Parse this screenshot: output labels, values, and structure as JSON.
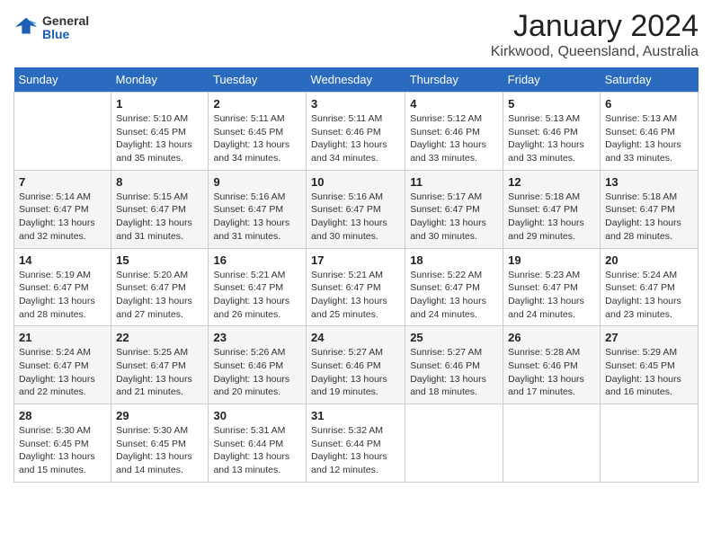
{
  "header": {
    "logo_general": "General",
    "logo_blue": "Blue",
    "month_title": "January 2024",
    "location": "Kirkwood, Queensland, Australia"
  },
  "weekdays": [
    "Sunday",
    "Monday",
    "Tuesday",
    "Wednesday",
    "Thursday",
    "Friday",
    "Saturday"
  ],
  "weeks": [
    [
      {
        "day": "",
        "sunrise": "",
        "sunset": "",
        "daylight": ""
      },
      {
        "day": "1",
        "sunrise": "Sunrise: 5:10 AM",
        "sunset": "Sunset: 6:45 PM",
        "daylight": "Daylight: 13 hours and 35 minutes."
      },
      {
        "day": "2",
        "sunrise": "Sunrise: 5:11 AM",
        "sunset": "Sunset: 6:45 PM",
        "daylight": "Daylight: 13 hours and 34 minutes."
      },
      {
        "day": "3",
        "sunrise": "Sunrise: 5:11 AM",
        "sunset": "Sunset: 6:46 PM",
        "daylight": "Daylight: 13 hours and 34 minutes."
      },
      {
        "day": "4",
        "sunrise": "Sunrise: 5:12 AM",
        "sunset": "Sunset: 6:46 PM",
        "daylight": "Daylight: 13 hours and 33 minutes."
      },
      {
        "day": "5",
        "sunrise": "Sunrise: 5:13 AM",
        "sunset": "Sunset: 6:46 PM",
        "daylight": "Daylight: 13 hours and 33 minutes."
      },
      {
        "day": "6",
        "sunrise": "Sunrise: 5:13 AM",
        "sunset": "Sunset: 6:46 PM",
        "daylight": "Daylight: 13 hours and 33 minutes."
      }
    ],
    [
      {
        "day": "7",
        "sunrise": "Sunrise: 5:14 AM",
        "sunset": "Sunset: 6:47 PM",
        "daylight": "Daylight: 13 hours and 32 minutes."
      },
      {
        "day": "8",
        "sunrise": "Sunrise: 5:15 AM",
        "sunset": "Sunset: 6:47 PM",
        "daylight": "Daylight: 13 hours and 31 minutes."
      },
      {
        "day": "9",
        "sunrise": "Sunrise: 5:16 AM",
        "sunset": "Sunset: 6:47 PM",
        "daylight": "Daylight: 13 hours and 31 minutes."
      },
      {
        "day": "10",
        "sunrise": "Sunrise: 5:16 AM",
        "sunset": "Sunset: 6:47 PM",
        "daylight": "Daylight: 13 hours and 30 minutes."
      },
      {
        "day": "11",
        "sunrise": "Sunrise: 5:17 AM",
        "sunset": "Sunset: 6:47 PM",
        "daylight": "Daylight: 13 hours and 30 minutes."
      },
      {
        "day": "12",
        "sunrise": "Sunrise: 5:18 AM",
        "sunset": "Sunset: 6:47 PM",
        "daylight": "Daylight: 13 hours and 29 minutes."
      },
      {
        "day": "13",
        "sunrise": "Sunrise: 5:18 AM",
        "sunset": "Sunset: 6:47 PM",
        "daylight": "Daylight: 13 hours and 28 minutes."
      }
    ],
    [
      {
        "day": "14",
        "sunrise": "Sunrise: 5:19 AM",
        "sunset": "Sunset: 6:47 PM",
        "daylight": "Daylight: 13 hours and 28 minutes."
      },
      {
        "day": "15",
        "sunrise": "Sunrise: 5:20 AM",
        "sunset": "Sunset: 6:47 PM",
        "daylight": "Daylight: 13 hours and 27 minutes."
      },
      {
        "day": "16",
        "sunrise": "Sunrise: 5:21 AM",
        "sunset": "Sunset: 6:47 PM",
        "daylight": "Daylight: 13 hours and 26 minutes."
      },
      {
        "day": "17",
        "sunrise": "Sunrise: 5:21 AM",
        "sunset": "Sunset: 6:47 PM",
        "daylight": "Daylight: 13 hours and 25 minutes."
      },
      {
        "day": "18",
        "sunrise": "Sunrise: 5:22 AM",
        "sunset": "Sunset: 6:47 PM",
        "daylight": "Daylight: 13 hours and 24 minutes."
      },
      {
        "day": "19",
        "sunrise": "Sunrise: 5:23 AM",
        "sunset": "Sunset: 6:47 PM",
        "daylight": "Daylight: 13 hours and 24 minutes."
      },
      {
        "day": "20",
        "sunrise": "Sunrise: 5:24 AM",
        "sunset": "Sunset: 6:47 PM",
        "daylight": "Daylight: 13 hours and 23 minutes."
      }
    ],
    [
      {
        "day": "21",
        "sunrise": "Sunrise: 5:24 AM",
        "sunset": "Sunset: 6:47 PM",
        "daylight": "Daylight: 13 hours and 22 minutes."
      },
      {
        "day": "22",
        "sunrise": "Sunrise: 5:25 AM",
        "sunset": "Sunset: 6:47 PM",
        "daylight": "Daylight: 13 hours and 21 minutes."
      },
      {
        "day": "23",
        "sunrise": "Sunrise: 5:26 AM",
        "sunset": "Sunset: 6:46 PM",
        "daylight": "Daylight: 13 hours and 20 minutes."
      },
      {
        "day": "24",
        "sunrise": "Sunrise: 5:27 AM",
        "sunset": "Sunset: 6:46 PM",
        "daylight": "Daylight: 13 hours and 19 minutes."
      },
      {
        "day": "25",
        "sunrise": "Sunrise: 5:27 AM",
        "sunset": "Sunset: 6:46 PM",
        "daylight": "Daylight: 13 hours and 18 minutes."
      },
      {
        "day": "26",
        "sunrise": "Sunrise: 5:28 AM",
        "sunset": "Sunset: 6:46 PM",
        "daylight": "Daylight: 13 hours and 17 minutes."
      },
      {
        "day": "27",
        "sunrise": "Sunrise: 5:29 AM",
        "sunset": "Sunset: 6:45 PM",
        "daylight": "Daylight: 13 hours and 16 minutes."
      }
    ],
    [
      {
        "day": "28",
        "sunrise": "Sunrise: 5:30 AM",
        "sunset": "Sunset: 6:45 PM",
        "daylight": "Daylight: 13 hours and 15 minutes."
      },
      {
        "day": "29",
        "sunrise": "Sunrise: 5:30 AM",
        "sunset": "Sunset: 6:45 PM",
        "daylight": "Daylight: 13 hours and 14 minutes."
      },
      {
        "day": "30",
        "sunrise": "Sunrise: 5:31 AM",
        "sunset": "Sunset: 6:44 PM",
        "daylight": "Daylight: 13 hours and 13 minutes."
      },
      {
        "day": "31",
        "sunrise": "Sunrise: 5:32 AM",
        "sunset": "Sunset: 6:44 PM",
        "daylight": "Daylight: 13 hours and 12 minutes."
      },
      {
        "day": "",
        "sunrise": "",
        "sunset": "",
        "daylight": ""
      },
      {
        "day": "",
        "sunrise": "",
        "sunset": "",
        "daylight": ""
      },
      {
        "day": "",
        "sunrise": "",
        "sunset": "",
        "daylight": ""
      }
    ]
  ]
}
